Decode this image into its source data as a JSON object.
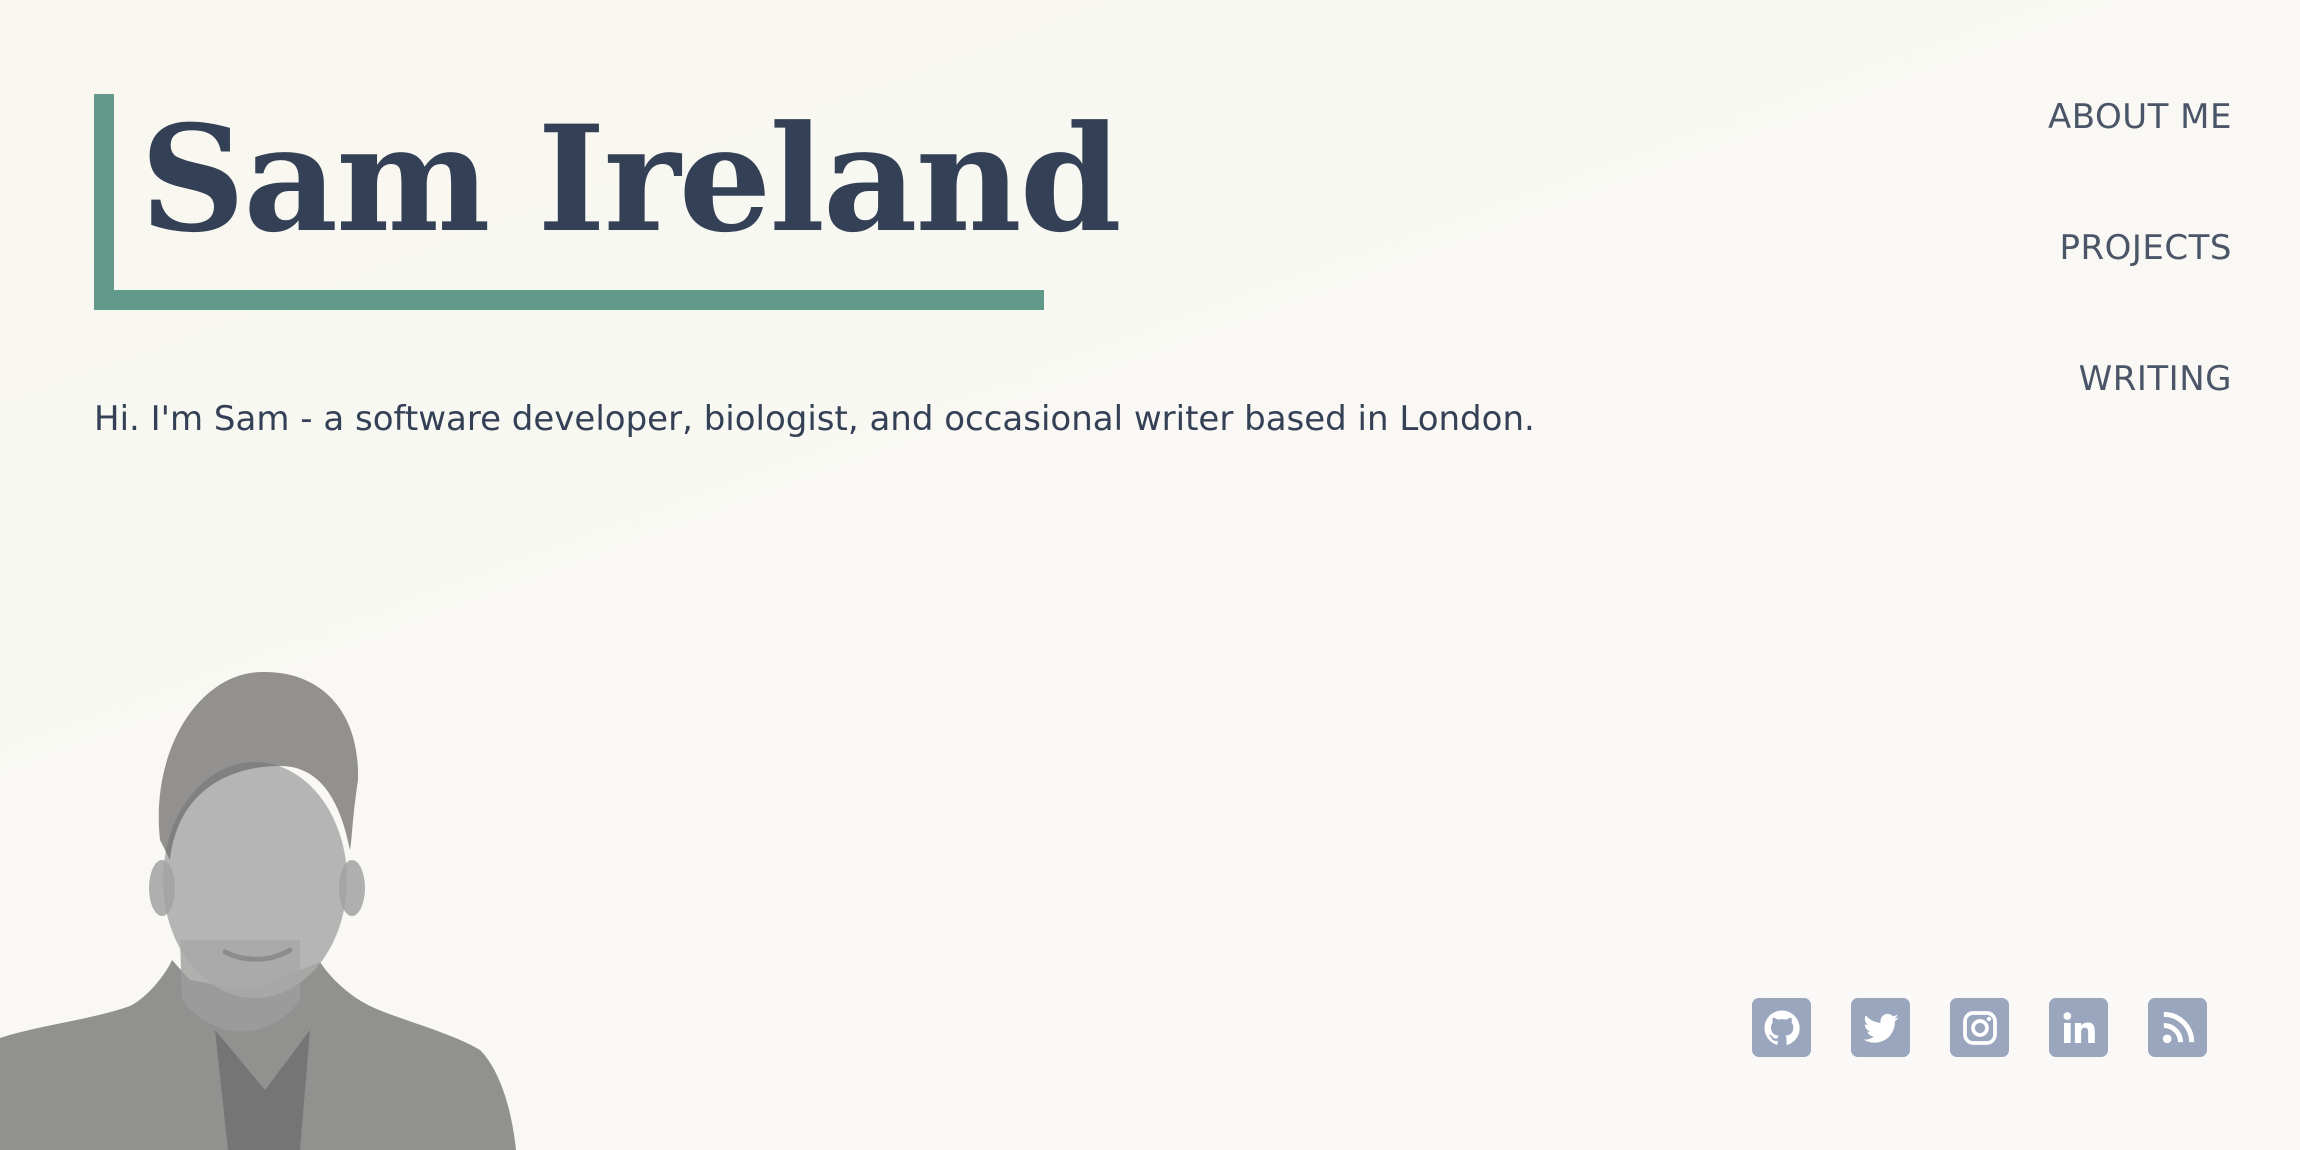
{
  "header": {
    "title": "Sam Ireland"
  },
  "intro": {
    "text": "Hi. I'm Sam - a software developer, biologist, and occasional writer based in London."
  },
  "nav": {
    "items": [
      {
        "label": "About Me"
      },
      {
        "label": "Projects"
      },
      {
        "label": "Writing"
      }
    ]
  },
  "social": {
    "icons": [
      "github-icon",
      "twitter-icon",
      "instagram-icon",
      "linkedin-icon",
      "rss-icon"
    ]
  },
  "colors": {
    "accent": "#619a8a",
    "text": "#344055",
    "nav_text": "#4a5568",
    "icon_bg": "#9aa6bd",
    "background": "#f8f8f2"
  }
}
